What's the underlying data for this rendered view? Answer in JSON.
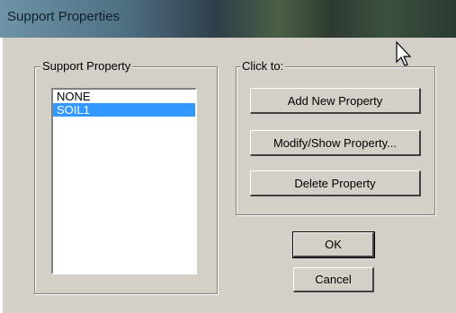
{
  "dialog": {
    "title": "Support Properties"
  },
  "support_property_group": {
    "label": "Support Property",
    "items": [
      {
        "label": "NONE",
        "selected": false
      },
      {
        "label": "SOIL1",
        "selected": true
      }
    ]
  },
  "click_to_group": {
    "label": "Click to:",
    "add_new_property": "Add New Property",
    "modify_show_property": "Modify/Show Property...",
    "delete_property": "Delete Property"
  },
  "buttons": {
    "ok": "OK",
    "cancel": "Cancel"
  },
  "colors": {
    "dialog_bg": "#d4d0c8",
    "selection": "#3399ff"
  },
  "icons": {
    "cursor": "mouse-pointer-icon"
  }
}
